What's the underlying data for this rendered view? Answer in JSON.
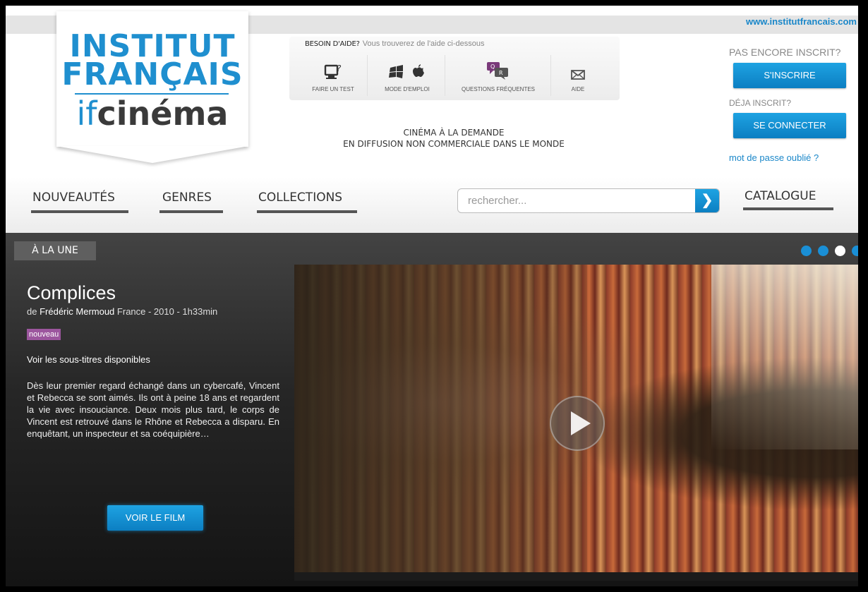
{
  "header": {
    "site_link": "www.institutfrancais.com",
    "logo": {
      "line1": "INSTITUT",
      "line2": "FRANÇAIS",
      "if": "if",
      "cinema": "cinéma"
    },
    "help": {
      "title": "BESOIN D'AIDE?",
      "subtitle": "Vous trouverez de l'aide ci-dessous",
      "items": [
        {
          "label": "FAIRE UN TEST",
          "icon": "monitor-question-icon"
        },
        {
          "label": "MODE D'EMPLOI",
          "icon": "windows-apple-icon"
        },
        {
          "label": "QUESTIONS FRÉQUENTES",
          "icon": "qa-bubbles-icon"
        },
        {
          "label": "AIDE",
          "icon": "envelope-icon"
        }
      ]
    },
    "tagline": {
      "line1": "CINÉMA À LA DEMANDE",
      "line2": "EN DIFFUSION NON COMMERCIALE DANS LE MONDE"
    },
    "account": {
      "not_registered": "PAS ENCORE INSCRIT?",
      "register_button": "S'INSCRIRE",
      "registered": "DÉJA INSCRIT?",
      "login_button": "SE CONNECTER",
      "forgot_password": "mot de passe oublié ?"
    }
  },
  "nav": {
    "items": [
      "NOUVEAUTÉS",
      "GENRES",
      "COLLECTIONS"
    ],
    "catalogue": "CATALOGUE",
    "search_placeholder": "rechercher...",
    "search_button": "❯"
  },
  "feature": {
    "section_label": "À LA UNE",
    "carousel": {
      "count": 4,
      "active_index": 2
    },
    "film": {
      "title": "Complices",
      "director_prefix": "de",
      "director": "Frédéric Mermoud",
      "meta": "France - 2010 - 1h33min",
      "badge": "nouveau",
      "subtitles_link": "Voir les sous-titres disponibles",
      "synopsis": "Dès leur premier regard échangé dans un cybercafé, Vincent et Rebecca se sont aimés. Ils ont à peine 18 ans et regardent la vie avec insouciance. Deux mois plus tard, le corps de Vincent est retrouvé dans le Rhône et Rebecca a disparu. En enquêtant, un inspecteur et sa coéquipière…",
      "watch_button": "VOIR LE FILM"
    }
  },
  "colors": {
    "accent": "#1a8fd6",
    "badge": "#9c569e",
    "dark_bg": "#262626"
  }
}
